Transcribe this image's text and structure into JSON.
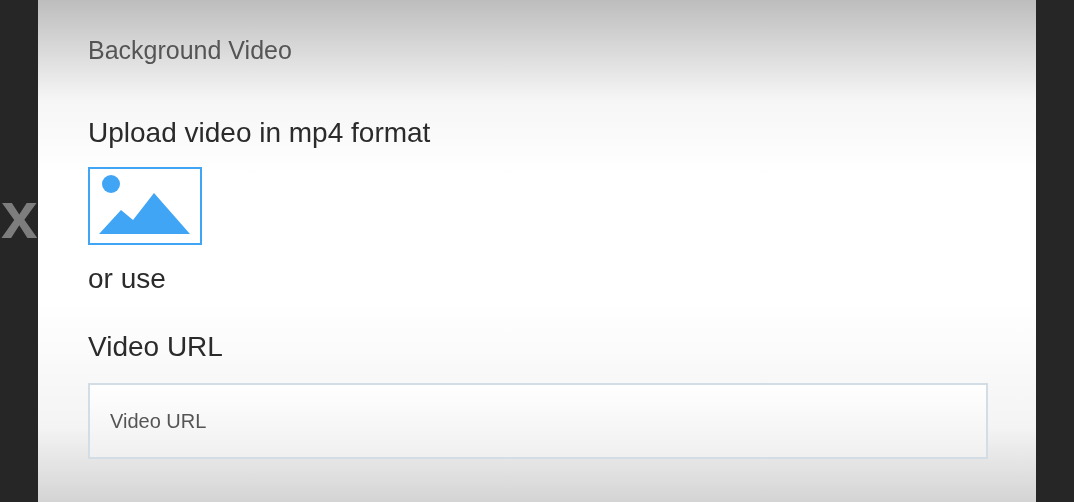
{
  "backdrop": {
    "text_left": "x"
  },
  "dialog": {
    "title": "Background Video",
    "upload_label": "Upload video in mp4 format",
    "or_text": "or use",
    "url_label": "Video URL",
    "url_field": {
      "placeholder": "Video URL"
    }
  }
}
